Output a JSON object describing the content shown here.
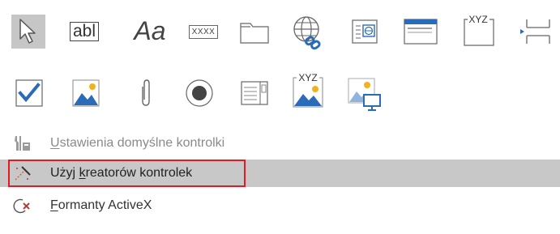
{
  "controls_row1": [
    {
      "name": "select-pointer-icon"
    },
    {
      "name": "text-box-icon",
      "text": "abl"
    },
    {
      "name": "label-icon",
      "text": "Aa"
    },
    {
      "name": "button-icon",
      "text": "XXXX"
    },
    {
      "name": "tab-control-icon"
    },
    {
      "name": "hyperlink-icon"
    },
    {
      "name": "web-browser-control-icon"
    },
    {
      "name": "navigation-control-icon"
    },
    {
      "name": "option-group-icon",
      "text": "XYZ"
    },
    {
      "name": "page-break-icon"
    }
  ],
  "controls_row2": [
    {
      "name": "check-box-icon"
    },
    {
      "name": "image-icon"
    },
    {
      "name": "attachment-icon"
    },
    {
      "name": "option-button-icon"
    },
    {
      "name": "list-box-icon"
    },
    {
      "name": "unbound-object-frame-icon",
      "text": "XYZ"
    },
    {
      "name": "bound-object-frame-icon"
    }
  ],
  "menu": {
    "defaults_prefix": "U",
    "defaults_rest": "stawienia domyślne kontrolki",
    "wizards_pre": "Użyj ",
    "wizards_key": "k",
    "wizards_post": "reatorów kontrolek",
    "activex_key": "F",
    "activex_rest": "ormanty ActiveX"
  },
  "colors": {
    "accent_blue": "#2b6cb8",
    "highlight_gray": "#c8c8c8",
    "red_box": "#e21b23",
    "selected_gray": "#c6c6c6"
  }
}
